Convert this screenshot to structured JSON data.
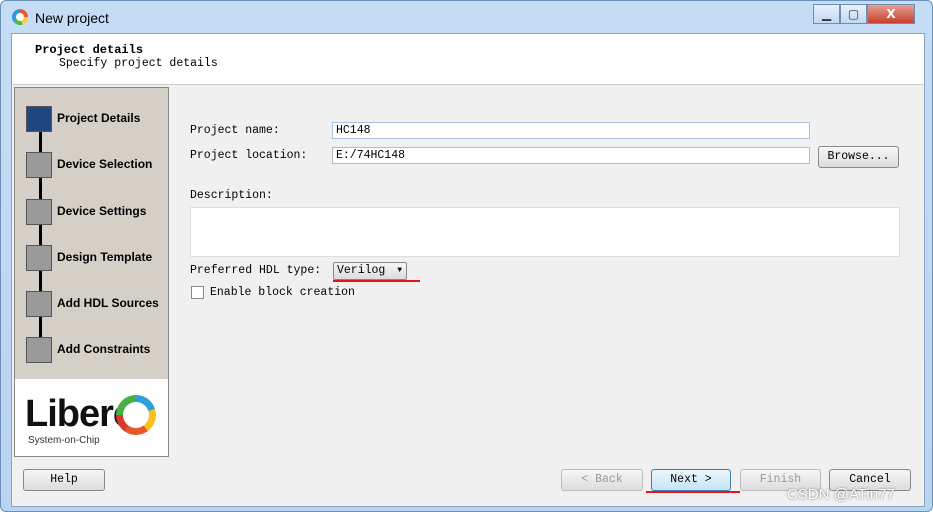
{
  "window": {
    "title": "New project"
  },
  "header": {
    "title": "Project details",
    "subtitle": "Specify project details"
  },
  "steps": [
    {
      "label": "Project Details",
      "active": true
    },
    {
      "label": "Device Selection"
    },
    {
      "label": "Device Settings"
    },
    {
      "label": "Design Template"
    },
    {
      "label": "Add HDL Sources"
    },
    {
      "label": "Add Constraints"
    }
  ],
  "logo": {
    "text": "Libero",
    "tagline": "System-on-Chip"
  },
  "form": {
    "name_label": "Project name:",
    "name_value": "HC148",
    "location_label": "Project location:",
    "location_value": "E:/74HC148",
    "browse": "Browse...",
    "description_label": "Description:",
    "description_value": "",
    "hdl_label": "Preferred HDL type:",
    "hdl_value": "Verilog",
    "block_label": "Enable block creation",
    "block_checked": false
  },
  "footer": {
    "help": "Help",
    "back": "< Back",
    "next": "Next >",
    "finish": "Finish",
    "cancel": "Cancel"
  },
  "watermark": "CSDN @ATin77",
  "colors": {
    "annotation": "#e0141e",
    "active_step": "#1f477f"
  }
}
